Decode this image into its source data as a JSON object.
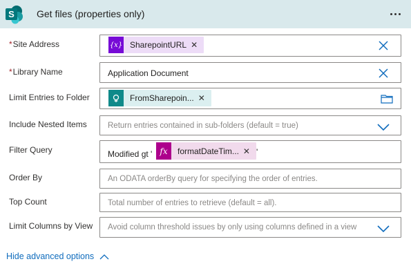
{
  "header": {
    "app_icon": "sharepoint-icon",
    "app_icon_letter": "S",
    "title": "Get files (properties only)",
    "more_icon": "ellipsis-icon"
  },
  "fields": {
    "site_address": {
      "label": "Site Address",
      "required_mark": "*",
      "token": {
        "label": "SharepointURL",
        "icon": "variable-icon",
        "icon_text": "{x}",
        "color": "#770bd6"
      }
    },
    "library_name": {
      "label": "Library Name",
      "required_mark": "*",
      "value": "Application Document"
    },
    "limit_folder": {
      "label": "Limit Entries to Folder",
      "token": {
        "label": "FromSharepoin...",
        "icon": "power-apps-icon",
        "color": "#0f8a8a"
      },
      "folder_icon": "folder-icon"
    },
    "include_nested": {
      "label": "Include Nested Items",
      "placeholder": "Return entries contained in sub-folders (default = true)"
    },
    "filter_query": {
      "label": "Filter Query",
      "prefix": "Modified gt '",
      "suffix": "'",
      "token": {
        "label": "formatDateTim...",
        "icon": "function-icon",
        "icon_text": "fx",
        "color": "#ad008c"
      }
    },
    "order_by": {
      "label": "Order By",
      "placeholder": "An ODATA orderBy query for specifying the order of entries."
    },
    "top_count": {
      "label": "Top Count",
      "placeholder": "Total number of entries to retrieve (default = all)."
    },
    "limit_columns": {
      "label": "Limit Columns by View",
      "placeholder": "Avoid column threshold issues by only using columns defined in a view"
    }
  },
  "advanced_link": {
    "label": "Hide advanced options",
    "icon": "chevron-up-icon"
  },
  "colors": {
    "header_bg": "#d9e9ec",
    "link": "#0f6cbd",
    "required": "#a4262c",
    "variable_token_bg": "#eddcf7",
    "flow_token_bg": "#dbeff0",
    "function_token_bg": "#f1daec"
  }
}
